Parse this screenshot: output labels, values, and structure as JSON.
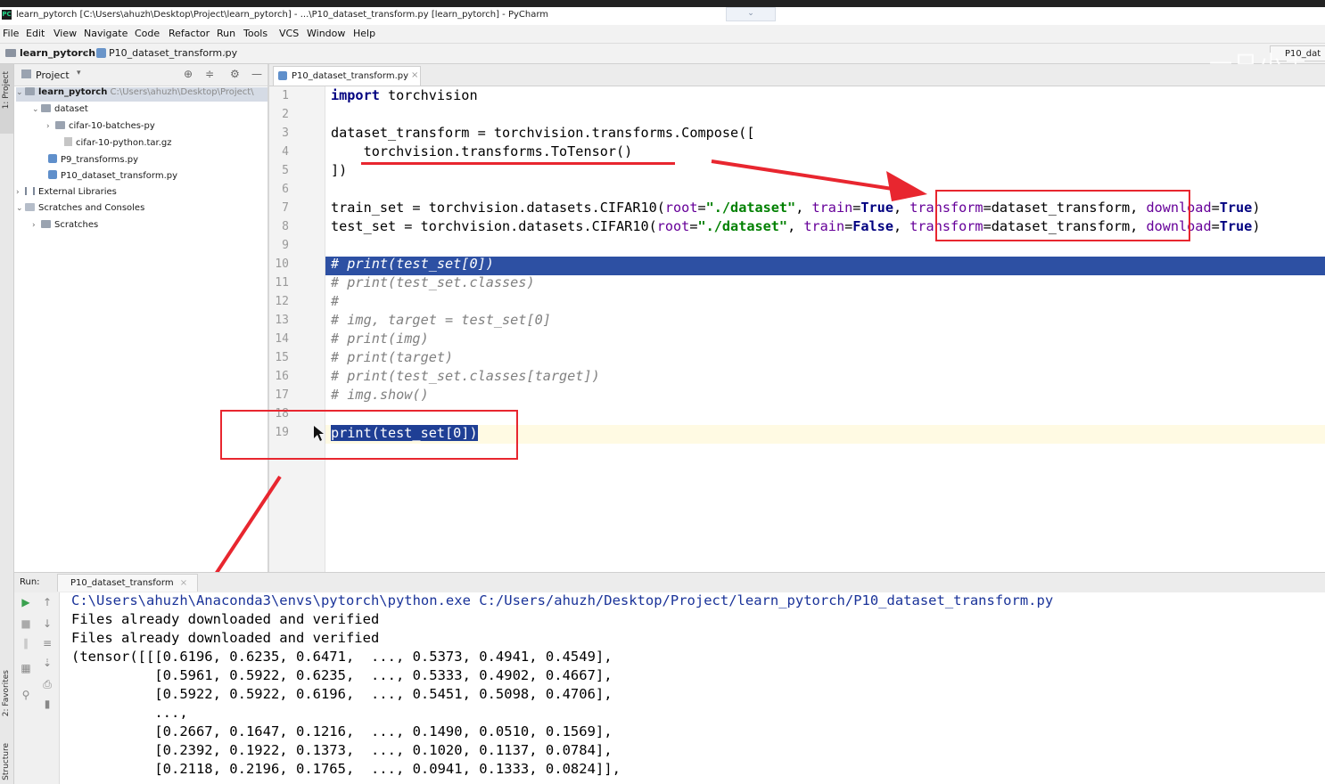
{
  "window": {
    "title": "learn_pytorch [C:\\Users\\ahuzh\\Desktop\\Project\\learn_pytorch] - ...\\P10_dataset_transform.py [learn_pytorch] - PyCharm",
    "app_icon": "PC"
  },
  "menu": [
    "File",
    "Edit",
    "View",
    "Navigate",
    "Code",
    "Refactor",
    "Run",
    "Tools",
    "VCS",
    "Window",
    "Help"
  ],
  "breadcrumb": {
    "project": "learn_pytorch",
    "file": "P10_dataset_transform.py",
    "right_tab": "P10_dat"
  },
  "watermark": "一只小土",
  "left_toolbar": {
    "project": "1: Project",
    "favorites": "2: Favorites",
    "structure": "Structure"
  },
  "project_panel": {
    "header": "Project",
    "tree": [
      {
        "label": "learn_pytorch",
        "path": "C:\\Users\\ahuzh\\Desktop\\Project\\"
      },
      {
        "label": "dataset"
      },
      {
        "label": "cifar-10-batches-py"
      },
      {
        "label": "cifar-10-python.tar.gz"
      },
      {
        "label": "P9_transforms.py"
      },
      {
        "label": "P10_dataset_transform.py"
      },
      {
        "label": "External Libraries"
      },
      {
        "label": "Scratches and Consoles"
      },
      {
        "label": "Scratches"
      }
    ]
  },
  "editor": {
    "tab": "P10_dataset_transform.py",
    "line_numbers": [
      "1",
      "2",
      "3",
      "4",
      "5",
      "6",
      "7",
      "8",
      "9",
      "10",
      "11",
      "12",
      "13",
      "14",
      "15",
      "16",
      "17",
      "18",
      "19"
    ],
    "code": {
      "l1_kw": "import",
      "l1_rest": " torchvision",
      "l3": "dataset_transform = torchvision.transforms.Compose([",
      "l4": "    torchvision.transforms.ToTensor()",
      "l5": "])",
      "l7_a": "train_set = torchvision.datasets.CIFAR10(",
      "l7_root": "root",
      "l7_b": "=",
      "l7_str": "\"./dataset\"",
      "l7_c": ", ",
      "l7_train": "train",
      "l7_d": "=",
      "l7_val": "True",
      "l7_e": ", ",
      "l7_tr": "transform",
      "l7_f": "=dataset_transform, ",
      "l7_dl": "download",
      "l7_g": "=",
      "l7_dlv": "True",
      "l7_h": ")",
      "l8_a": "test_set = torchvision.datasets.CIFAR10(",
      "l8_root": "root",
      "l8_b": "=",
      "l8_str": "\"./dataset\"",
      "l8_c": ", ",
      "l8_train": "train",
      "l8_d": "=",
      "l8_val": "False",
      "l8_e": ", ",
      "l8_tr": "transform",
      "l8_f": "=dataset_transform, ",
      "l8_dl": "download",
      "l8_g": "=",
      "l8_dlv": "True",
      "l8_h": ")",
      "l10": "# print(test_set[0])",
      "l11": "# print(test_set.classes)",
      "l12": "#",
      "l13": "# img, target = test_set[0]",
      "l14": "# print(img)",
      "l15": "# print(target)",
      "l16": "# print(test_set.classes[target])",
      "l17": "# img.show()",
      "l19": "print(test_set[0])"
    }
  },
  "run": {
    "label": "Run:",
    "tab": "P10_dataset_transform",
    "console": [
      "C:\\Users\\ahuzh\\Anaconda3\\envs\\pytorch\\python.exe C:/Users/ahuzh/Desktop/Project/learn_pytorch/P10_dataset_transform.py",
      "Files already downloaded and verified",
      "Files already downloaded and verified",
      "(tensor([[[0.6196, 0.6235, 0.6471,  ..., 0.5373, 0.4941, 0.4549],",
      "          [0.5961, 0.5922, 0.6235,  ..., 0.5333, 0.4902, 0.4667],",
      "          [0.5922, 0.5922, 0.6196,  ..., 0.5451, 0.5098, 0.4706],",
      "          ...,",
      "          [0.2667, 0.1647, 0.1216,  ..., 0.1490, 0.0510, 0.1569],",
      "          [0.2392, 0.1922, 0.1373,  ..., 0.1020, 0.1137, 0.0784],",
      "          [0.2118, 0.2196, 0.1765,  ..., 0.0941, 0.1333, 0.0824]],"
    ]
  },
  "colors": {
    "annotation_red": "#e8262f",
    "selection_blue": "#2d50a3",
    "keyword": "#000080",
    "string": "#008000",
    "param": "#660099",
    "comment": "#808080"
  }
}
